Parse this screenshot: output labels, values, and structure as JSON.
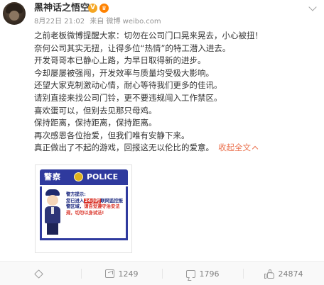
{
  "post": {
    "author": "黑神话之悟空",
    "verified_mark": "V",
    "vip_mark": "♛",
    "date": "8月22日 21:02",
    "source_prefix": "来自",
    "source": "微博 weibo.com",
    "lines": [
      "之前老板微博提醒大家：切勿在公司门口晃来晃去，小心被扭！",
      "奈何公司其实无扭，让得多位“热情”的特工潜入进去。",
      "开发哥哥本已静心上路，为早日取得新的进步。",
      "今却屡屡被强闯，开发效率与质量均受极大影响。",
      "还望大家克制激动心情，耐心等待我们更多的佳讯。",
      "请别直接来找公司门铃，更不要违规闯入工作禁区。",
      "喜欢蛋可以，但别去见那只母鸡。",
      "保持距离，保持距离，保持距离。",
      "再次感恩各位抬爱，但我们唯有安静下来。"
    ],
    "last_line": "真正做出了不起的游戏，回报这无以伦比的爱意。",
    "collapse_label": "收起全文"
  },
  "image": {
    "banner_cn": "警察",
    "banner_en": "POLICE",
    "notice_title": "警方提示:",
    "notice_pre": "您已进入",
    "notice_hl": "24小时",
    "notice_mid": "联网监控报警区域，",
    "notice_red": "请自觉遵守治安法规，切勿以身试法!"
  },
  "actions": {
    "share_count": "1249",
    "comment_count": "1796",
    "like_count": "24874"
  },
  "icons": {
    "star": "star-icon",
    "share": "share-icon",
    "comment": "comment-icon",
    "like": "like-icon",
    "more": "chevron-down-icon"
  },
  "colors": {
    "link": "#eb7350",
    "police_blue": "#2f3a9e",
    "verified": "#f5a623"
  }
}
